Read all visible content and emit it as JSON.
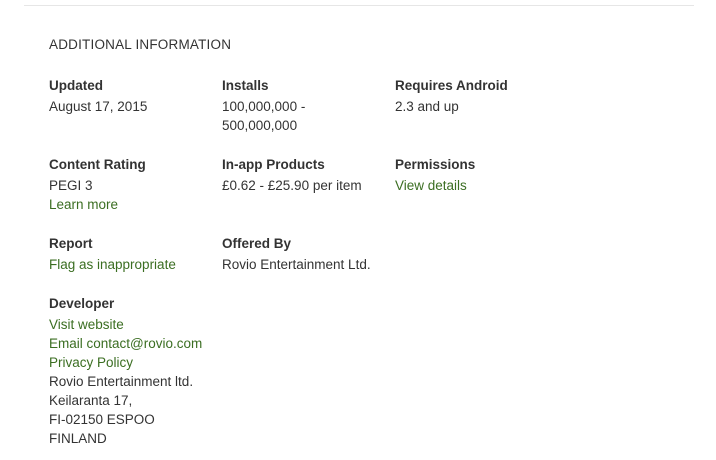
{
  "section_title": "ADDITIONAL INFORMATION",
  "colors": {
    "link": "#3b6e22",
    "text": "#333333",
    "divider": "#e6e6e6"
  },
  "updated": {
    "title": "Updated",
    "value": "August 17, 2015"
  },
  "installs": {
    "title": "Installs",
    "value_line1": "100,000,000 -",
    "value_line2": "500,000,000"
  },
  "requires_android": {
    "title": "Requires Android",
    "value": "2.3 and up"
  },
  "content_rating": {
    "title": "Content Rating",
    "value": "PEGI 3",
    "link": "Learn more"
  },
  "in_app_products": {
    "title": "In-app Products",
    "value": "£0.62 - £25.90 per item"
  },
  "permissions": {
    "title": "Permissions",
    "link": "View details"
  },
  "report": {
    "title": "Report",
    "link": "Flag as inappropriate"
  },
  "offered_by": {
    "title": "Offered By",
    "value": "Rovio Entertainment Ltd."
  },
  "developer": {
    "title": "Developer",
    "website_link": "Visit website",
    "email_link": "Email contact@rovio.com",
    "privacy_link": "Privacy Policy",
    "address": [
      "Rovio Entertainment ltd.",
      "Keilaranta 17,",
      "FI-02150 ESPOO",
      "FINLAND"
    ]
  }
}
